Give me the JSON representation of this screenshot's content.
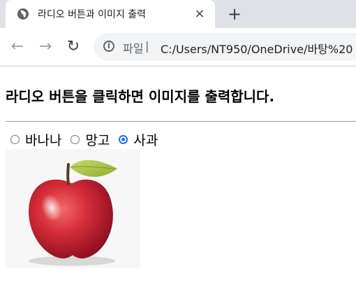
{
  "browser": {
    "tab_title": "라디오 버튼과 이미지 출력",
    "tab_close": "×",
    "new_tab": "+",
    "nav": {
      "back": "←",
      "forward": "→",
      "reload": "↻"
    },
    "address_bar": {
      "scheme_label": "파일",
      "separator": "|",
      "url": "C:/Users/NT950/OneDrive/바탕%20"
    }
  },
  "page": {
    "heading": "라디오 버튼을 클릭하면 이미지를 출력합니다.",
    "radios": [
      {
        "label": "바나나",
        "checked": false
      },
      {
        "label": "망고",
        "checked": false
      },
      {
        "label": "사과",
        "checked": true
      }
    ],
    "image": {
      "subject": "apple"
    }
  },
  "colors": {
    "tabstrip_bg": "#dee1e6",
    "omnibox_bg": "#f1f3f4",
    "radio_accent": "#1a73e8"
  }
}
